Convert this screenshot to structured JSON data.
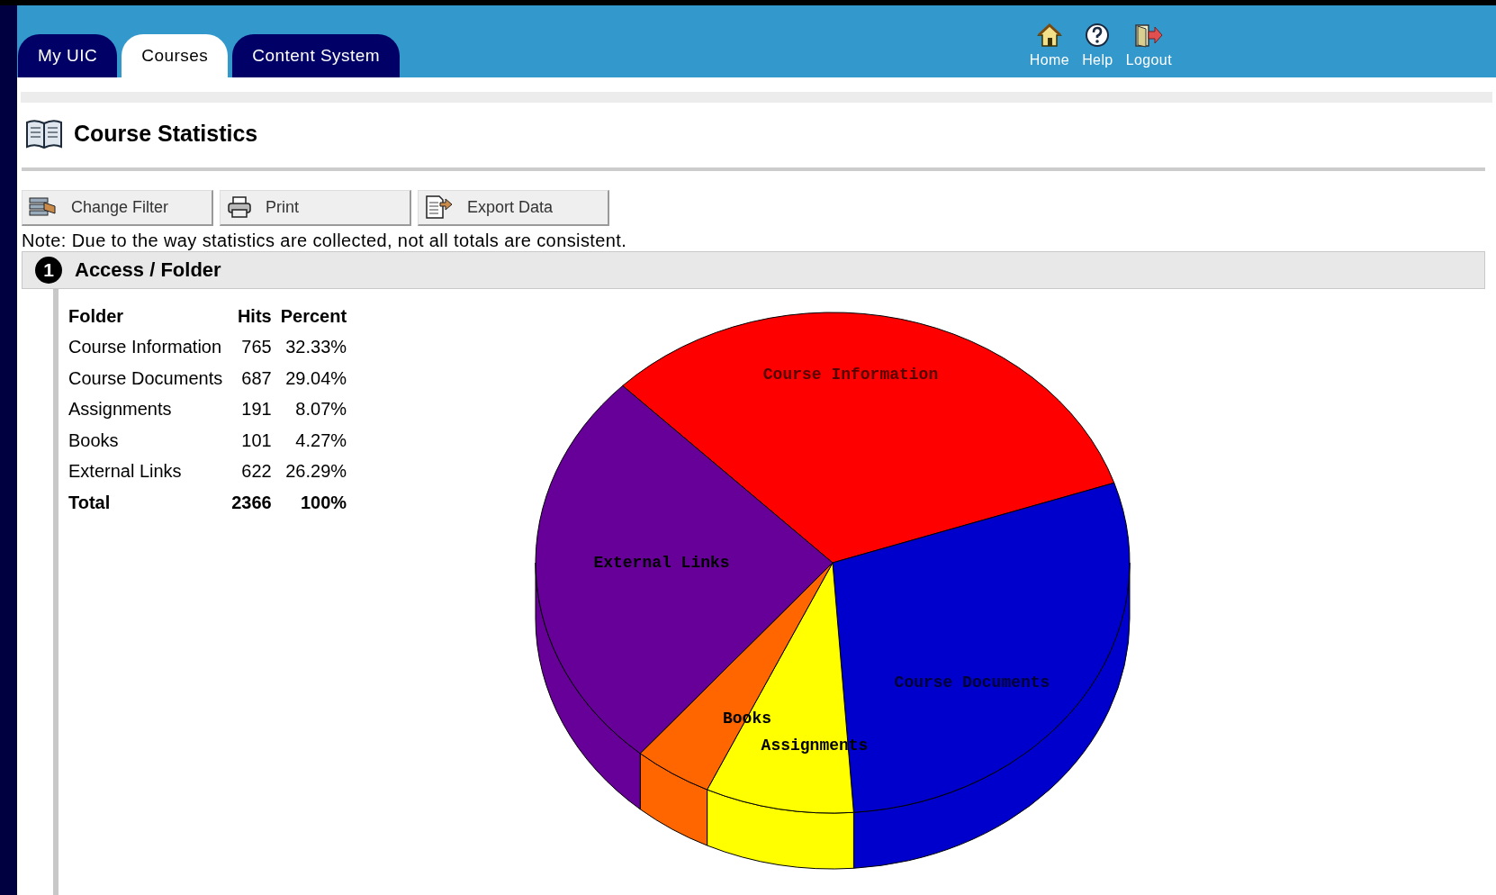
{
  "tabs": [
    {
      "label": "My UIC",
      "selected": false
    },
    {
      "label": "Courses",
      "selected": true
    },
    {
      "label": "Content System",
      "selected": false
    }
  ],
  "header_links": [
    {
      "label": "Home",
      "kind": "home"
    },
    {
      "label": "Help",
      "kind": "help"
    },
    {
      "label": "Logout",
      "kind": "logout"
    }
  ],
  "page_title": "Course Statistics",
  "buttons": [
    {
      "label": "Change Filter",
      "kind": "filter"
    },
    {
      "label": "Print",
      "kind": "print"
    },
    {
      "label": "Export Data",
      "kind": "export"
    }
  ],
  "note": "Note: Due to the way statistics are collected, not all totals are consistent.",
  "section": {
    "number": "1",
    "title": "Access / Folder"
  },
  "table": {
    "columns": [
      "Folder",
      "Hits",
      "Percent"
    ],
    "rows": [
      {
        "folder": "Course Information",
        "hits": "765",
        "percent": "32.33%"
      },
      {
        "folder": "Course Documents",
        "hits": "687",
        "percent": "29.04%"
      },
      {
        "folder": "Assignments",
        "hits": "191",
        "percent": "8.07%"
      },
      {
        "folder": "Books",
        "hits": "101",
        "percent": "4.27%"
      },
      {
        "folder": "External Links",
        "hits": "622",
        "percent": "26.29%"
      }
    ],
    "total": {
      "folder": "Total",
      "hits": "2366",
      "percent": "100%"
    }
  },
  "chart": {
    "slice_labels": [
      "Course Information",
      "Course Documents",
      "Assignments",
      "Books",
      "External Links"
    ]
  }
}
